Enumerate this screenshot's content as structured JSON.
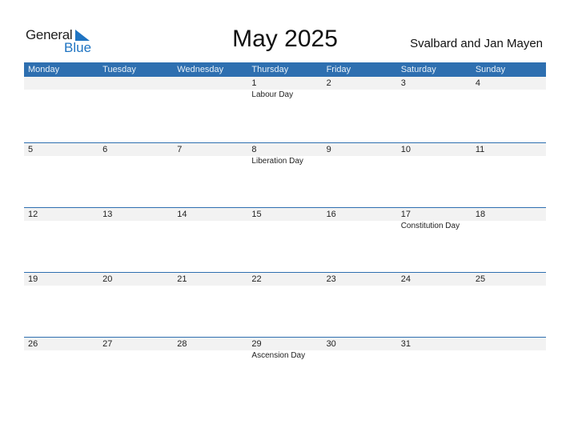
{
  "logo": {
    "general": "General",
    "blue": "Blue"
  },
  "title": "May 2025",
  "region": "Svalbard and Jan Mayen",
  "accent_color": "#2e6fb0",
  "weekdays": [
    "Monday",
    "Tuesday",
    "Wednesday",
    "Thursday",
    "Friday",
    "Saturday",
    "Sunday"
  ],
  "weeks": [
    {
      "days": [
        "",
        "",
        "",
        "1",
        "2",
        "3",
        "4"
      ],
      "events": [
        "",
        "",
        "",
        "Labour Day",
        "",
        "",
        ""
      ]
    },
    {
      "days": [
        "5",
        "6",
        "7",
        "8",
        "9",
        "10",
        "11"
      ],
      "events": [
        "",
        "",
        "",
        "Liberation Day",
        "",
        "",
        ""
      ]
    },
    {
      "days": [
        "12",
        "13",
        "14",
        "15",
        "16",
        "17",
        "18"
      ],
      "events": [
        "",
        "",
        "",
        "",
        "",
        "Constitution Day",
        ""
      ]
    },
    {
      "days": [
        "19",
        "20",
        "21",
        "22",
        "23",
        "24",
        "25"
      ],
      "events": [
        "",
        "",
        "",
        "",
        "",
        "",
        ""
      ]
    },
    {
      "days": [
        "26",
        "27",
        "28",
        "29",
        "30",
        "31",
        ""
      ],
      "events": [
        "",
        "",
        "",
        "Ascension Day",
        "",
        "",
        ""
      ]
    }
  ]
}
